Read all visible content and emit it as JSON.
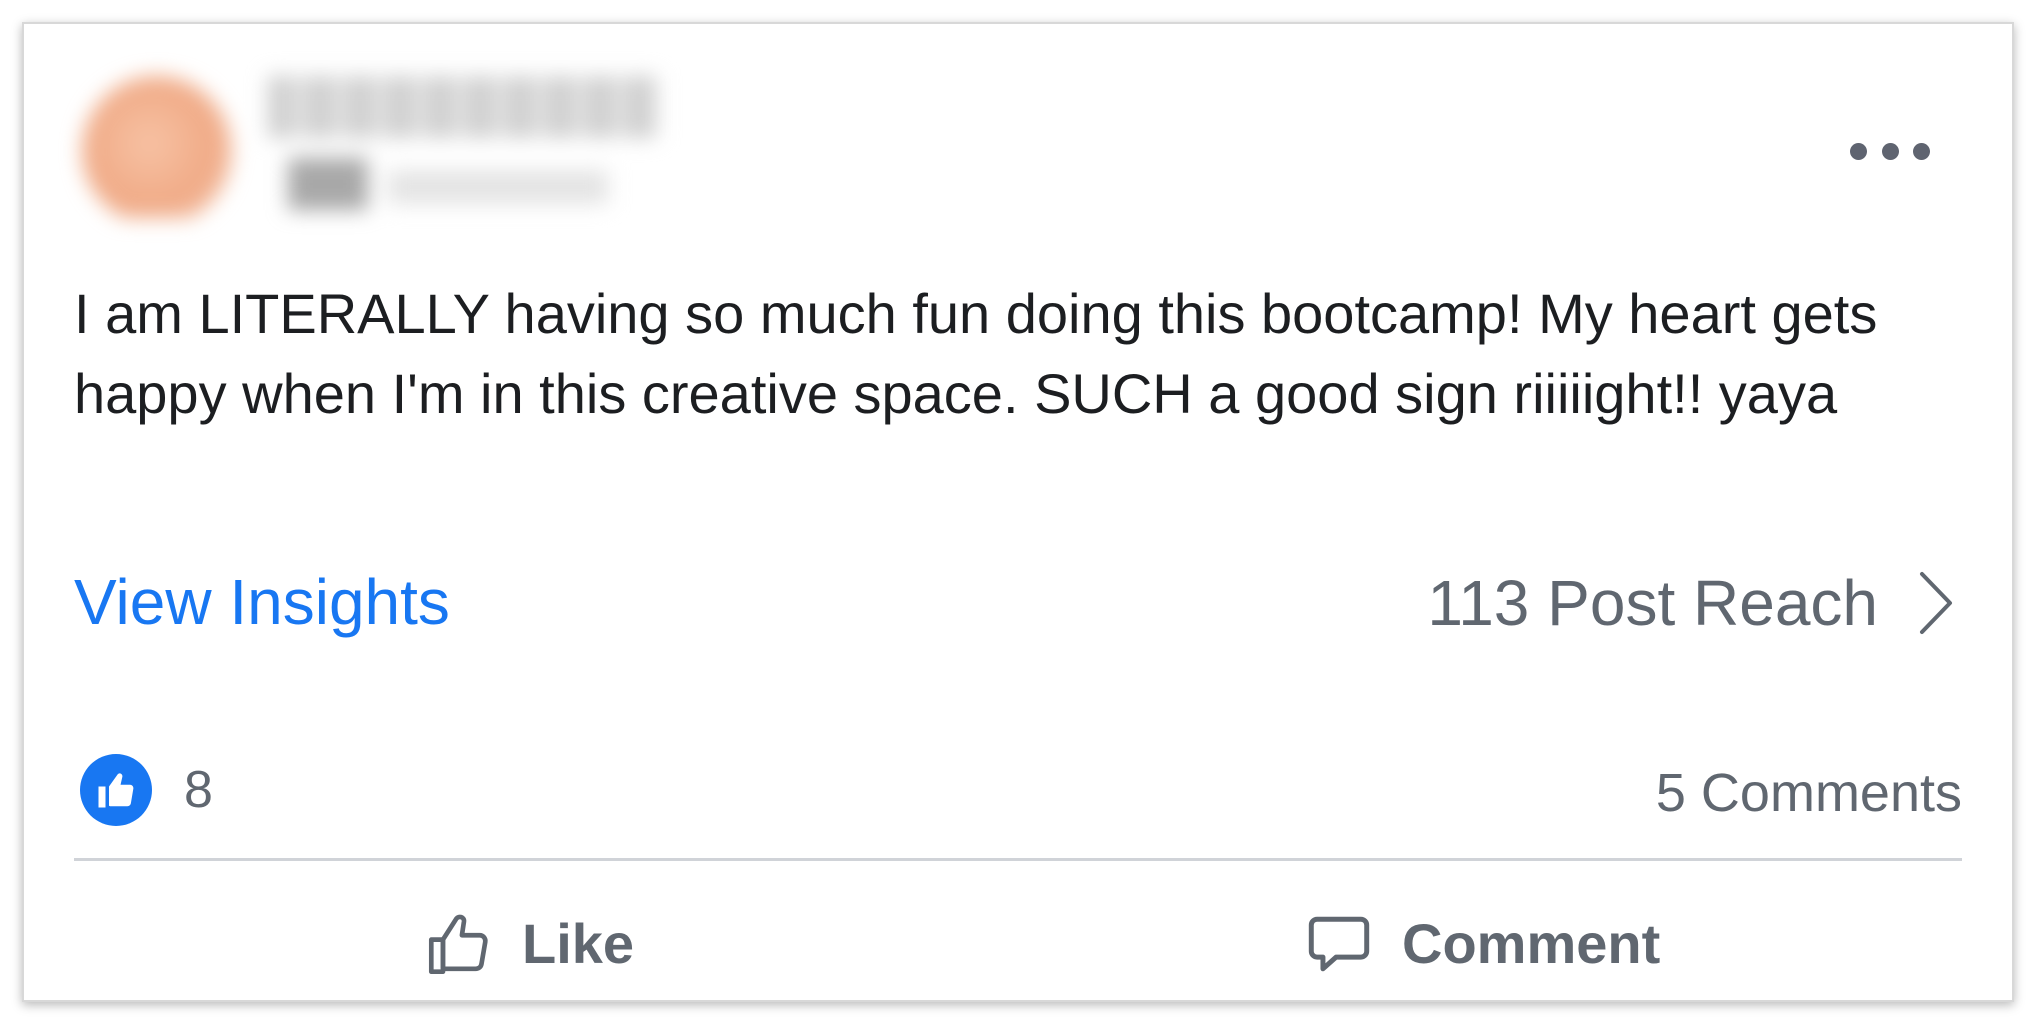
{
  "post": {
    "text": "I am LITERALLY having so much fun doing this bootcamp! My heart gets happy when I'm in this creative space. SUCH a good sign riiiiight!! yaya"
  },
  "insights": {
    "link_label": "View Insights",
    "reach_label": "113 Post Reach"
  },
  "engagement": {
    "reaction_count": "8",
    "comments_label": "5 Comments"
  },
  "actions": {
    "like_label": "Like",
    "comment_label": "Comment"
  },
  "icons": {
    "more": "more-horizontal-icon",
    "reach_arrow": "chevron-right-icon",
    "reaction": "thumbs-up-icon",
    "like": "thumbs-up-outline-icon",
    "comment": "speech-bubble-icon"
  },
  "colors": {
    "link": "#1877f2",
    "secondary_text": "#606770",
    "body_text": "#1c1e21"
  }
}
